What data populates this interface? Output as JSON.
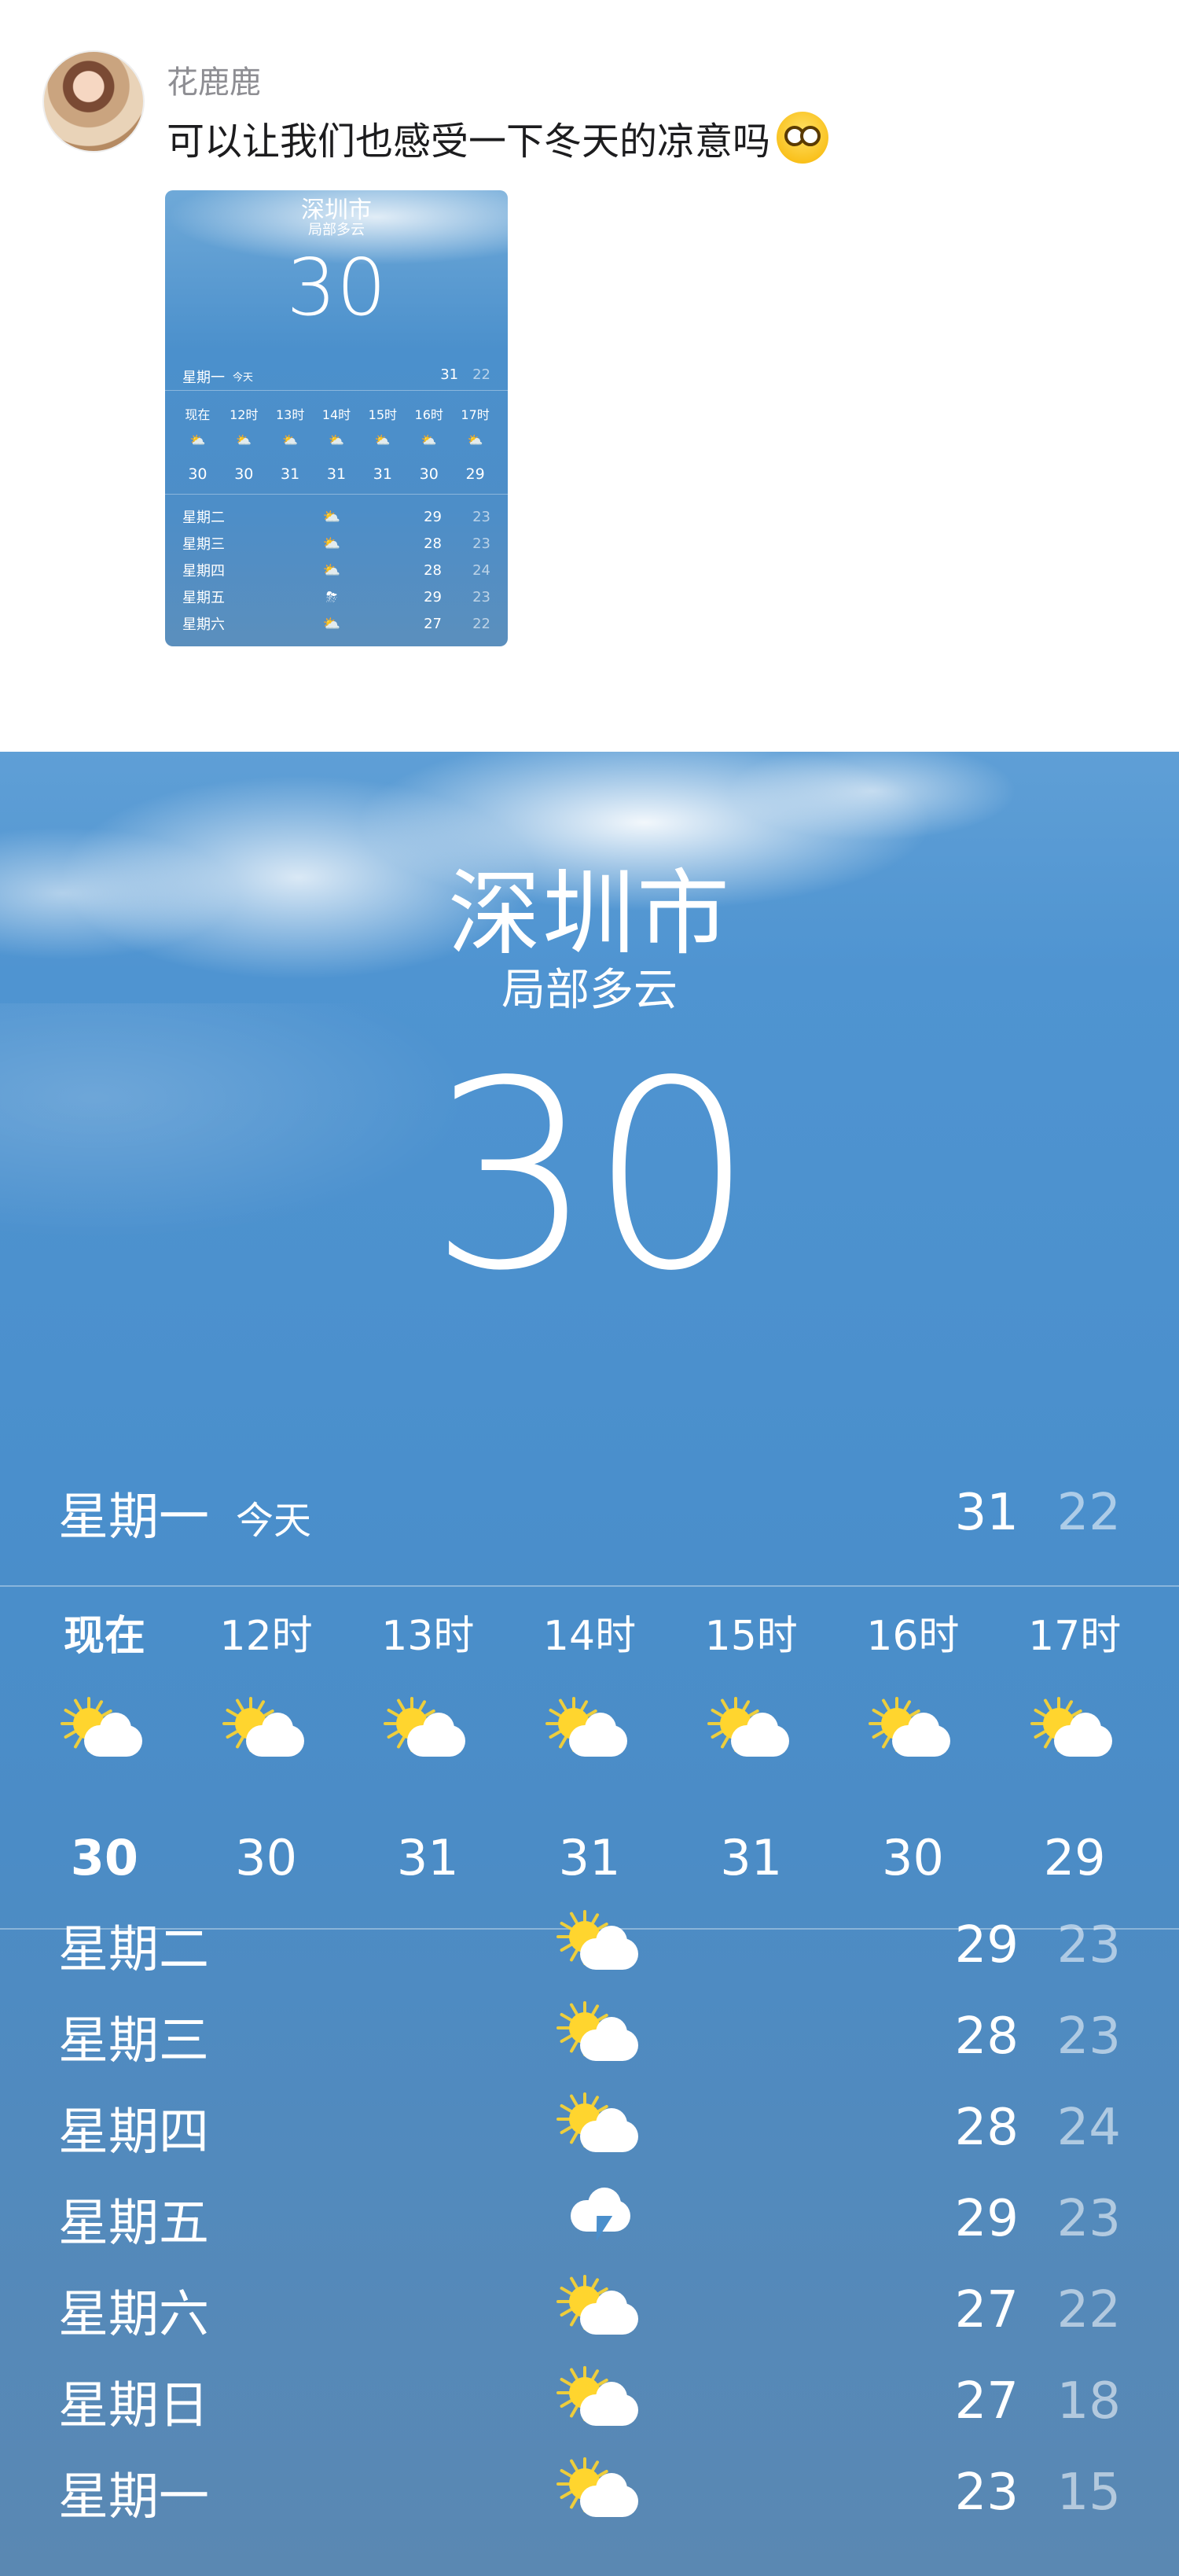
{
  "post": {
    "username": "花鹿鹿",
    "text": "可以让我们也感受一下冬天的凉意吗",
    "emoji": "blushing-face-emoji"
  },
  "thumbnail": {
    "city": "深圳市",
    "condition": "局部多云",
    "temp": "30",
    "today": {
      "day": "星期一",
      "tag": "今天",
      "hi": "31",
      "lo": "22"
    },
    "hours": [
      "现在",
      "12时",
      "13时",
      "14时",
      "15时",
      "16时",
      "17时"
    ],
    "hour_temps": [
      "30",
      "30",
      "31",
      "31",
      "31",
      "30",
      "29"
    ],
    "days": [
      {
        "name": "星期二",
        "icon": "partly-cloudy",
        "hi": "29",
        "lo": "23"
      },
      {
        "name": "星期三",
        "icon": "partly-cloudy",
        "hi": "28",
        "lo": "23"
      },
      {
        "name": "星期四",
        "icon": "partly-cloudy",
        "hi": "28",
        "lo": "24"
      },
      {
        "name": "星期五",
        "icon": "thunderstorm",
        "hi": "29",
        "lo": "23"
      },
      {
        "name": "星期六",
        "icon": "partly-cloudy",
        "hi": "27",
        "lo": "22"
      }
    ]
  },
  "weather": {
    "city": "深圳市",
    "condition": "局部多云",
    "temp": "30",
    "today": {
      "day": "星期一",
      "tag": "今天",
      "hi": "31",
      "lo": "22"
    },
    "hours": [
      "现在",
      "12时",
      "13时",
      "14时",
      "15时",
      "16时",
      "17时"
    ],
    "hour_icons": [
      "partly-cloudy",
      "partly-cloudy",
      "partly-cloudy",
      "partly-cloudy",
      "partly-cloudy",
      "partly-cloudy",
      "partly-cloudy"
    ],
    "hour_temps": [
      "30",
      "30",
      "31",
      "31",
      "31",
      "30",
      "29"
    ],
    "days": [
      {
        "name": "星期二",
        "icon": "partly-cloudy",
        "hi": "29",
        "lo": "23"
      },
      {
        "name": "星期三",
        "icon": "partly-cloudy",
        "hi": "28",
        "lo": "23"
      },
      {
        "name": "星期四",
        "icon": "partly-cloudy",
        "hi": "28",
        "lo": "24"
      },
      {
        "name": "星期五",
        "icon": "thunderstorm",
        "hi": "29",
        "lo": "23"
      },
      {
        "name": "星期六",
        "icon": "partly-cloudy",
        "hi": "27",
        "lo": "22"
      },
      {
        "name": "星期日",
        "icon": "partly-cloudy",
        "hi": "27",
        "lo": "18"
      },
      {
        "name": "星期一",
        "icon": "partly-cloudy",
        "hi": "23",
        "lo": "15"
      }
    ]
  },
  "colors": {
    "sky": "#4a8fcc",
    "sun": "#ffd52e",
    "muted_text": "#8e8e93"
  }
}
